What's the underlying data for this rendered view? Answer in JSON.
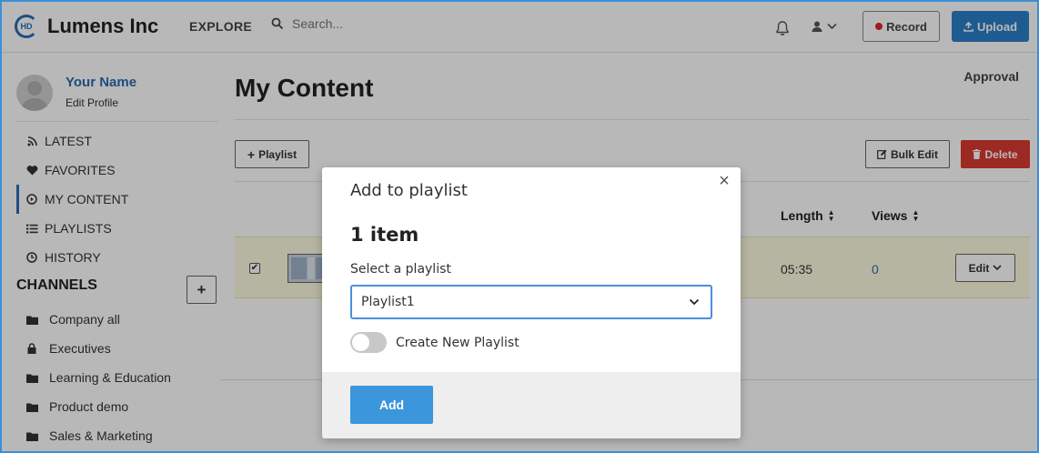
{
  "header": {
    "logo_mark": "HD",
    "brand": "Lumens Inc",
    "explore": "EXPLORE",
    "search_placeholder": "Search...",
    "record_label": "Record",
    "upload_label": "Upload"
  },
  "profile": {
    "name": "Your Name",
    "edit": "Edit Profile"
  },
  "nav": {
    "items": [
      {
        "label": "LATEST",
        "icon": "rss-icon"
      },
      {
        "label": "FAVORITES",
        "icon": "heart-icon"
      },
      {
        "label": "MY CONTENT",
        "icon": "play-circle-icon",
        "active": true
      },
      {
        "label": "PLAYLISTS",
        "icon": "list-icon"
      },
      {
        "label": "HISTORY",
        "icon": "clock-icon"
      }
    ]
  },
  "channels": {
    "heading": "CHANNELS",
    "add_label": "+",
    "items": [
      {
        "label": "Company all",
        "icon": "folder-icon"
      },
      {
        "label": "Executives",
        "icon": "lock-icon"
      },
      {
        "label": "Learning & Education",
        "icon": "folder-icon"
      },
      {
        "label": "Product demo",
        "icon": "folder-icon"
      },
      {
        "label": "Sales & Marketing",
        "icon": "folder-icon"
      }
    ]
  },
  "main": {
    "title": "My Content",
    "approval": "Approval",
    "playlist_button": "Playlist",
    "bulk_edit": "Bulk Edit",
    "delete": "Delete",
    "columns": {
      "length": "Length",
      "views": "Views"
    },
    "rows": [
      {
        "checked": true,
        "length": "05:35",
        "views": "0",
        "edit": "Edit"
      }
    ]
  },
  "modal": {
    "title": "Add to playlist",
    "close": "×",
    "count": "1 item",
    "select_label": "Select a playlist",
    "select_value": "Playlist1",
    "toggle_label": "Create New Playlist",
    "toggle_on": false,
    "add_label": "Add"
  },
  "colors": {
    "accent": "#2a7fc9",
    "danger": "#d93a30",
    "link": "#2a6db3",
    "row_highlight": "#fdfbe0"
  }
}
